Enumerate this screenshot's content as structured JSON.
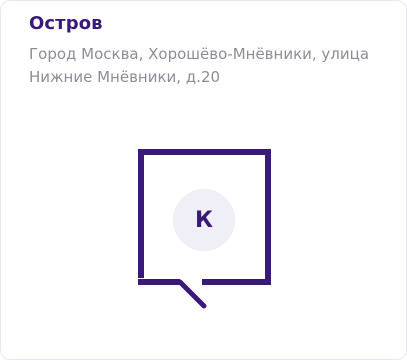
{
  "card": {
    "title": "Остров",
    "address": "Город Москва, Хорошёво-Мнёвники, улица Нижние Мнёвники, д.20",
    "logo_letter": "К"
  },
  "colors": {
    "title": "#3a1a78",
    "address": "#8f8c98",
    "marker_stroke": "#3a1a78",
    "circle_fill": "#f0eef6"
  }
}
